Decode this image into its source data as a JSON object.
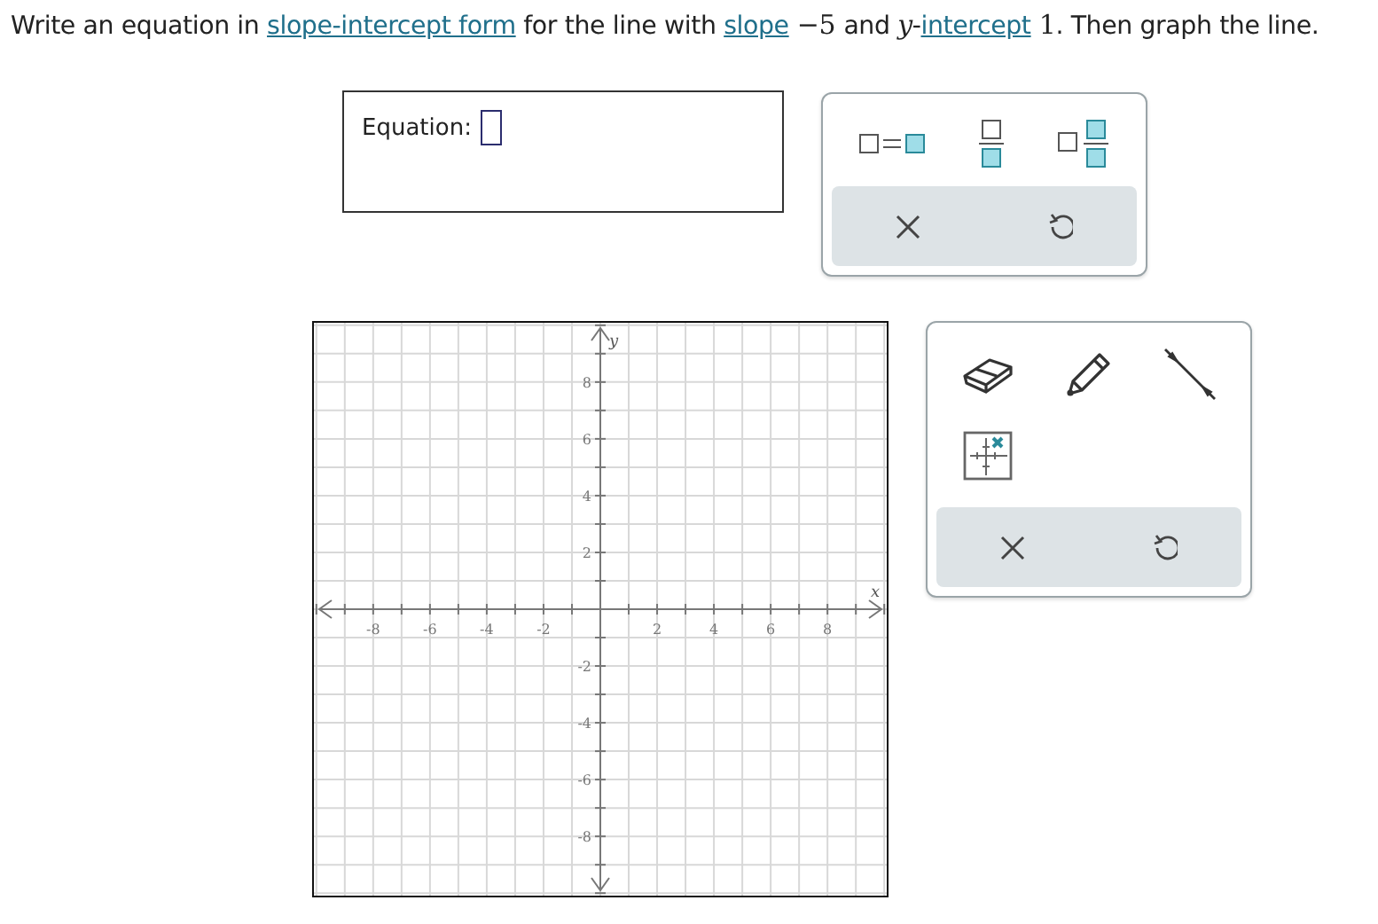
{
  "prompt": [
    {
      "kind": "text",
      "text": "Write an equation in "
    },
    {
      "kind": "link",
      "text": "slope-intercept form"
    },
    {
      "kind": "text",
      "text": " for the line with "
    },
    {
      "kind": "link",
      "text": "slope"
    },
    {
      "kind": "math",
      "text": " −5 "
    },
    {
      "kind": "text",
      "text": "and "
    },
    {
      "kind": "math",
      "text": "*y*-"
    },
    {
      "kind": "link",
      "text": "intercept"
    },
    {
      "kind": "math",
      "text": " 1"
    },
    {
      "kind": "text",
      "text": ". Then graph the line."
    }
  ],
  "equation": {
    "label": "Equation:"
  },
  "math_palette": {
    "templates": [
      {
        "kind": "equals"
      },
      {
        "kind": "fraction"
      },
      {
        "kind": "mixed"
      }
    ]
  },
  "graph": {
    "chart_data": {
      "type": "line",
      "grid": true,
      "xlabel": "x",
      "ylabel": "y",
      "xlim": [
        -10,
        10
      ],
      "ylim": [
        -10,
        10
      ],
      "xticks": [
        {
          "value": -8,
          "label": "-8"
        },
        {
          "value": -6,
          "label": "-6"
        },
        {
          "value": -4,
          "label": "-4"
        },
        {
          "value": -2,
          "label": "-2"
        },
        {
          "value": 2,
          "label": "2"
        },
        {
          "value": 4,
          "label": "4"
        },
        {
          "value": 6,
          "label": "6"
        },
        {
          "value": 8,
          "label": "8"
        }
      ],
      "yticks": [
        {
          "value": 8,
          "label": "8"
        },
        {
          "value": 6,
          "label": "6"
        },
        {
          "value": 4,
          "label": "4"
        },
        {
          "value": 2,
          "label": "2"
        },
        {
          "value": -2,
          "label": "-2"
        },
        {
          "value": -4,
          "label": "-4"
        },
        {
          "value": -6,
          "label": "-6"
        },
        {
          "value": -8,
          "label": "-8"
        }
      ]
    }
  },
  "graph_tools": {
    "tools": [
      {
        "kind": "eraser"
      },
      {
        "kind": "pencil"
      },
      {
        "kind": "line"
      },
      {
        "kind": "point"
      }
    ]
  }
}
